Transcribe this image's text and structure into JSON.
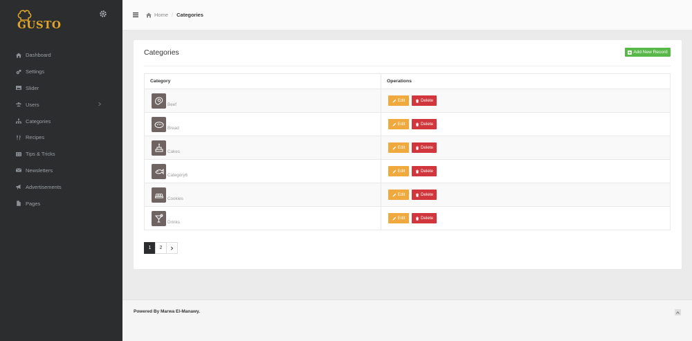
{
  "sidebar": {
    "logo_text": "GUSTO",
    "logo_color": "#e0a52b",
    "items": [
      {
        "label": "Dashboard",
        "icon": "home-icon"
      },
      {
        "label": "Settings",
        "icon": "cogs-icon"
      },
      {
        "label": "Slider",
        "icon": "image-icon"
      },
      {
        "label": "Users",
        "icon": "users-icon",
        "has_submenu": true
      },
      {
        "label": "Categories",
        "icon": "sitemap-icon"
      },
      {
        "label": "Recipes",
        "icon": "cutlery-icon"
      },
      {
        "label": "Tips & Tricks",
        "icon": "list-icon"
      },
      {
        "label": "Newsletters",
        "icon": "envelope-icon"
      },
      {
        "label": "Advertisements",
        "icon": "bullhorn-icon"
      },
      {
        "label": "Pages",
        "icon": "file-icon"
      }
    ]
  },
  "breadcrumb": {
    "home": "Home",
    "separator": "/",
    "current": "Categories"
  },
  "panel": {
    "title": "Categories",
    "add_button": "Add New Record",
    "table": {
      "headers": [
        "Category",
        "Operations"
      ],
      "rows": [
        {
          "name": "Beef",
          "icon": "steak-icon"
        },
        {
          "name": "Bread",
          "icon": "bread-icon"
        },
        {
          "name": "Cakes",
          "icon": "cake-icon"
        },
        {
          "name": "Category6",
          "icon": "fish-icon"
        },
        {
          "name": "Cookies",
          "icon": "cookies-icon"
        },
        {
          "name": "Drinks",
          "icon": "cocktail-icon"
        }
      ],
      "edit_label": "Edit",
      "delete_label": "Delete"
    },
    "pagination": {
      "pages": [
        "1",
        "2"
      ],
      "current": "1"
    }
  },
  "footer": {
    "text": "Powered By Marwa El-Manawy."
  },
  "colors": {
    "sidebar_bg": "#2b2d2f",
    "add_button": "#58b848",
    "edit_button": "#f0a93c",
    "delete_button": "#d0363b"
  }
}
